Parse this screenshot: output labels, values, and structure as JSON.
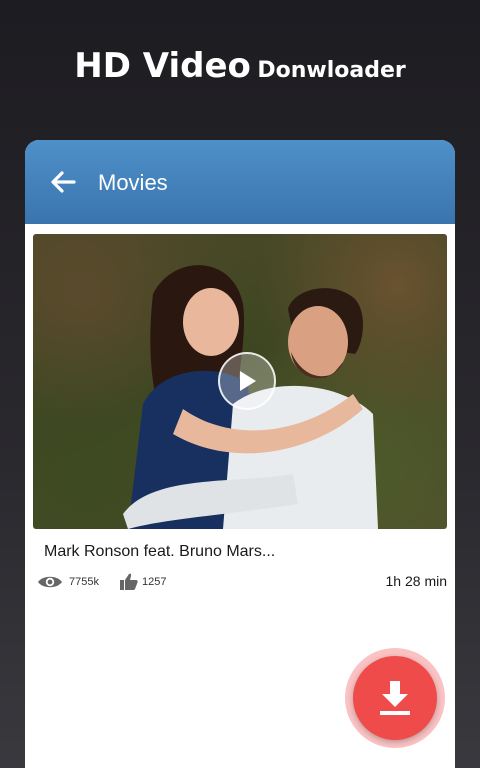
{
  "promo": {
    "title_large": "HD Video",
    "title_small": "Donwloader"
  },
  "appbar": {
    "title": "Movies",
    "back_icon": "arrow-left-icon"
  },
  "video": {
    "title": "Mark Ronson feat. Bruno Mars...",
    "views": "7755k",
    "likes": "1257",
    "duration": "1h 28 min",
    "thumbnail": "couple-hugging-photo"
  },
  "fab": {
    "icon": "download-icon"
  },
  "colors": {
    "appbar": "#4a87c2",
    "fab": "#f04b4b",
    "background": "#232227"
  }
}
